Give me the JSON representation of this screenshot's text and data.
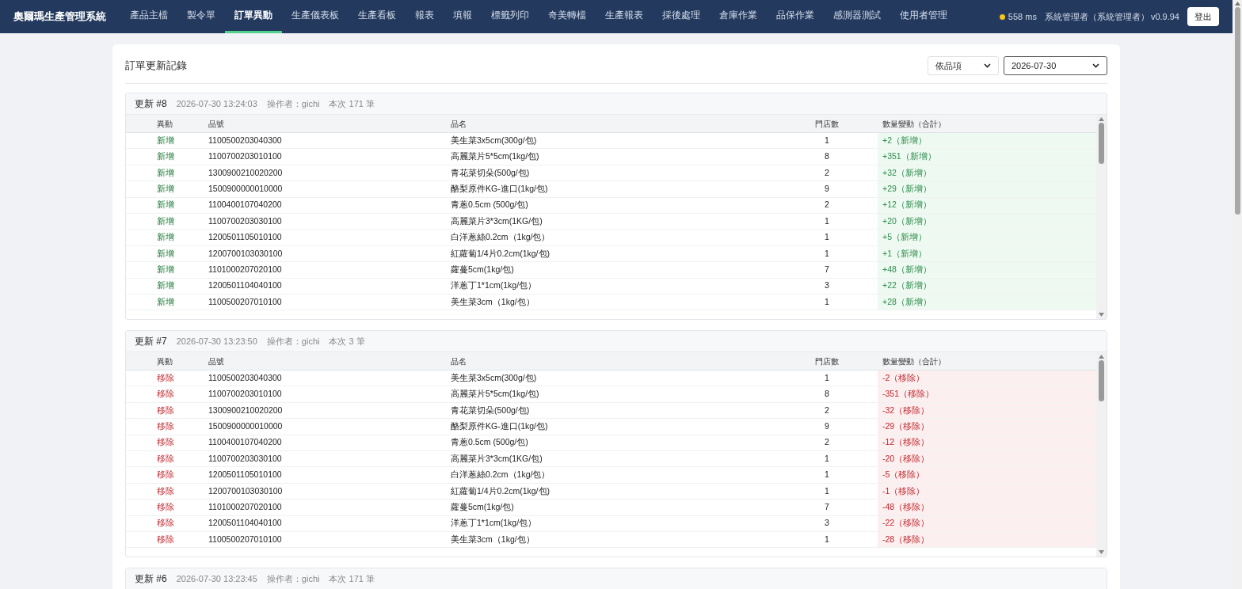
{
  "brand": "奧爾瑪生產管理系統",
  "nav": [
    {
      "label": "產品主檔",
      "selected": false
    },
    {
      "label": "製令單",
      "selected": false
    },
    {
      "label": "訂單異動",
      "selected": true
    },
    {
      "label": "生產儀表板",
      "selected": false
    },
    {
      "label": "生產看板",
      "selected": false
    },
    {
      "label": "報表",
      "selected": false
    },
    {
      "label": "填報",
      "selected": false
    },
    {
      "label": "標籤列印",
      "selected": false
    },
    {
      "label": "奇美轉檔",
      "selected": false
    },
    {
      "label": "生產報表",
      "selected": false
    },
    {
      "label": "採後處理",
      "selected": false
    },
    {
      "label": "倉庫作業",
      "selected": false
    },
    {
      "label": "品保作業",
      "selected": false
    },
    {
      "label": "感測器測試",
      "selected": false
    },
    {
      "label": "使用者管理",
      "selected": false
    }
  ],
  "status": {
    "latency": "558 ms",
    "color": "#f5c518",
    "user": "系統管理者（系統管理者）",
    "version": "v0.9.94",
    "logout": "登出"
  },
  "page_title": "訂單更新記錄",
  "filters": [
    {
      "value": "依品項",
      "focused": false
    },
    {
      "value": "2026-07-30",
      "focused": true
    }
  ],
  "updates": [
    {
      "title": "更新 #8",
      "time": "2026-07-30 13:24:03",
      "operator": "操作者：gichi",
      "count": "本次 171 筆",
      "columns": [
        "異動",
        "品號",
        "品名",
        "門店數",
        "數量變動（合計）"
      ],
      "rows": [
        {
          "kind": "added",
          "change": "新增",
          "code": "1100500203040300",
          "name": "美生菜3x5cm(300g/包)",
          "stores": "1",
          "delta": "+2（新增）"
        },
        {
          "kind": "added",
          "change": "新增",
          "code": "1100700203010100",
          "name": "高麗菜片5*5cm(1kg/包)",
          "stores": "8",
          "delta": "+351（新增）"
        },
        {
          "kind": "added",
          "change": "新增",
          "code": "1300900210020200",
          "name": "青花菜切朵(500g/包)",
          "stores": "2",
          "delta": "+32（新增）"
        },
        {
          "kind": "added",
          "change": "新增",
          "code": "1500900000010000",
          "name": "酪梨原件KG-進口(1kg/包)",
          "stores": "9",
          "delta": "+29（新增）"
        },
        {
          "kind": "added",
          "change": "新增",
          "code": "1100400107040200",
          "name": "青蔥0.5cm (500g/包)",
          "stores": "2",
          "delta": "+12（新增）"
        },
        {
          "kind": "added",
          "change": "新增",
          "code": "1100700203030100",
          "name": "高麗菜片3*3cm(1KG/包)",
          "stores": "1",
          "delta": "+20（新增）"
        },
        {
          "kind": "added",
          "change": "新增",
          "code": "1200501105010100",
          "name": "白洋蔥絲0.2cm（1kg/包）",
          "stores": "1",
          "delta": "+5（新增）"
        },
        {
          "kind": "added",
          "change": "新增",
          "code": "1200700103030100",
          "name": "紅蘿蔔1/4片0.2cm(1kg/包)",
          "stores": "1",
          "delta": "+1（新增）"
        },
        {
          "kind": "added",
          "change": "新增",
          "code": "1101000207020100",
          "name": "蘿蔓5cm(1kg/包)",
          "stores": "7",
          "delta": "+48（新增）"
        },
        {
          "kind": "added",
          "change": "新增",
          "code": "1200501104040100",
          "name": "洋蔥丁1*1cm(1kg/包）",
          "stores": "3",
          "delta": "+22（新增）"
        },
        {
          "kind": "added",
          "change": "新增",
          "code": "1100500207010100",
          "name": "美生菜3cm（1kg/包）",
          "stores": "1",
          "delta": "+28（新增）"
        }
      ]
    },
    {
      "title": "更新 #7",
      "time": "2026-07-30 13:23:50",
      "operator": "操作者：gichi",
      "count": "本次 3 筆",
      "columns": [
        "異動",
        "品號",
        "品名",
        "門店數",
        "數量變動（合計）"
      ],
      "rows": [
        {
          "kind": "removed",
          "change": "移除",
          "code": "1100500203040300",
          "name": "美生菜3x5cm(300g/包)",
          "stores": "1",
          "delta": "-2（移除）"
        },
        {
          "kind": "removed",
          "change": "移除",
          "code": "1100700203010100",
          "name": "高麗菜片5*5cm(1kg/包)",
          "stores": "8",
          "delta": "-351（移除）"
        },
        {
          "kind": "removed",
          "change": "移除",
          "code": "1300900210020200",
          "name": "青花菜切朵(500g/包)",
          "stores": "2",
          "delta": "-32（移除）"
        },
        {
          "kind": "removed",
          "change": "移除",
          "code": "1500900000010000",
          "name": "酪梨原件KG-進口(1kg/包)",
          "stores": "9",
          "delta": "-29（移除）"
        },
        {
          "kind": "removed",
          "change": "移除",
          "code": "1100400107040200",
          "name": "青蔥0.5cm (500g/包)",
          "stores": "2",
          "delta": "-12（移除）"
        },
        {
          "kind": "removed",
          "change": "移除",
          "code": "1100700203030100",
          "name": "高麗菜片3*3cm(1KG/包)",
          "stores": "1",
          "delta": "-20（移除）"
        },
        {
          "kind": "removed",
          "change": "移除",
          "code": "1200501105010100",
          "name": "白洋蔥絲0.2cm（1kg/包）",
          "stores": "1",
          "delta": "-5（移除）"
        },
        {
          "kind": "removed",
          "change": "移除",
          "code": "1200700103030100",
          "name": "紅蘿蔔1/4片0.2cm(1kg/包)",
          "stores": "1",
          "delta": "-1（移除）"
        },
        {
          "kind": "removed",
          "change": "移除",
          "code": "1101000207020100",
          "name": "蘿蔓5cm(1kg/包)",
          "stores": "7",
          "delta": "-48（移除）"
        },
        {
          "kind": "removed",
          "change": "移除",
          "code": "1200501104040100",
          "name": "洋蔥丁1*1cm(1kg/包）",
          "stores": "3",
          "delta": "-22（移除）"
        },
        {
          "kind": "removed",
          "change": "移除",
          "code": "1100500207010100",
          "name": "美生菜3cm（1kg/包）",
          "stores": "1",
          "delta": "-28（移除）"
        }
      ]
    },
    {
      "title": "更新 #6",
      "time": "2026-07-30 13:23:45",
      "operator": "操作者：gichi",
      "count": "本次 171 筆"
    }
  ]
}
